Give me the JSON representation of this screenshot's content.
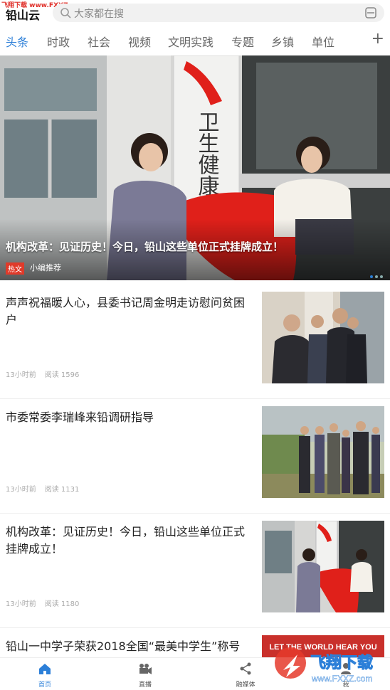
{
  "header": {
    "site_watermark": "飞翔下载 www.FXXZ.com",
    "app_title": "铅山云",
    "search_placeholder": "大家都在搜"
  },
  "tabs": [
    "头条",
    "时政",
    "社会",
    "视频",
    "文明实践",
    "专题",
    "乡镇",
    "单位"
  ],
  "tab_add": "+",
  "hero": {
    "caption": "机构改革：见证历史！今日，铅山这些单位正式挂牌成立！",
    "tag": "热文",
    "source": "小编推荐",
    "sign_text": "卫生健康"
  },
  "feed": [
    {
      "title": "声声祝福暖人心，县委书记周金明走访慰问贫困户",
      "time": "13小时前",
      "reads": "阅读 1596"
    },
    {
      "title": "市委常委李瑞峰来铅调研指导",
      "time": "13小时前",
      "reads": "阅读 1131"
    },
    {
      "title": "机构改革：见证历史！今日，铅山这些单位正式挂牌成立！",
      "time": "13小时前",
      "reads": "阅读 1180"
    },
    {
      "title": "铅山一中学子荣获2018全国“最美中学生”称号",
      "banner_text": "LET THE WORLD HEAR YOU"
    }
  ],
  "bottom_nav": [
    "首页",
    "直播",
    "融媒体",
    "我"
  ],
  "watermark": {
    "text": "飞翔下载",
    "url": "www.FXXZ.com"
  },
  "colors": {
    "accent": "#2c7fd8",
    "hot_tag": "#e03a2a",
    "red_cloth": "#e0201a"
  }
}
